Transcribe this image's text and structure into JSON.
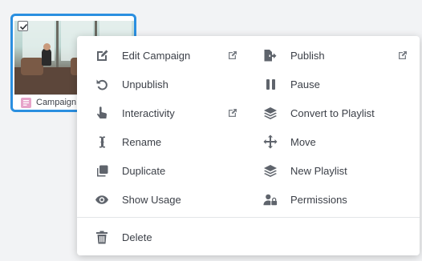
{
  "card": {
    "label": "Campaign"
  },
  "menu": {
    "left_items": [
      {
        "label": "Edit Campaign",
        "icon": "edit-icon",
        "external": true
      },
      {
        "label": "Unpublish",
        "icon": "undo-icon",
        "external": false
      },
      {
        "label": "Interactivity",
        "icon": "pointer-hand-icon",
        "external": true
      },
      {
        "label": "Rename",
        "icon": "text-cursor-icon",
        "external": false
      },
      {
        "label": "Duplicate",
        "icon": "duplicate-icon",
        "external": false
      },
      {
        "label": "Show Usage",
        "icon": "eye-icon",
        "external": false
      }
    ],
    "right_items": [
      {
        "label": "Publish",
        "icon": "publish-file-icon",
        "external": true
      },
      {
        "label": "Pause",
        "icon": "pause-icon",
        "external": false
      },
      {
        "label": "Convert to Playlist",
        "icon": "layers-icon",
        "external": false
      },
      {
        "label": "Move",
        "icon": "move-arrows-icon",
        "external": false
      },
      {
        "label": "New Playlist",
        "icon": "layers-icon",
        "external": false
      },
      {
        "label": "Permissions",
        "icon": "user-lock-icon",
        "external": false
      }
    ],
    "delete_label": "Delete"
  },
  "colors": {
    "selection_border": "#2b8fe0",
    "icon": "#5f646c",
    "campaign_badge": "#e6a3c9"
  }
}
